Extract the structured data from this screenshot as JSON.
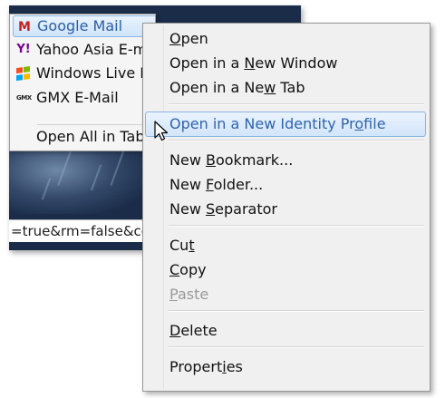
{
  "bookmarks_menu": {
    "items": [
      {
        "label": "Google Mail",
        "icon": "gmail-icon",
        "selected": true
      },
      {
        "label": "Yahoo Asia E-mail",
        "icon": "yahoo-icon"
      },
      {
        "label": "Windows Live E",
        "icon": "windows-icon"
      },
      {
        "label": "GMX E-Mail",
        "icon": "gmx-icon"
      }
    ],
    "open_all": "Open All in Tabs",
    "icons": {
      "gmail": "M",
      "yahoo": "Y!",
      "gmx": "GMX"
    }
  },
  "url_fragment": "=true&rm=false&co",
  "context_menu": {
    "items": [
      {
        "label": "Open",
        "accel": "O"
      },
      {
        "label": "Open in a New Window",
        "accel": "N"
      },
      {
        "label": "Open in a New Tab",
        "accel": "w"
      },
      {
        "label": "Open in a New Identity Profile",
        "accel": "o",
        "highlighted": true
      },
      {
        "label": "New Bookmark...",
        "accel": "B"
      },
      {
        "label": "New Folder...",
        "accel": "F"
      },
      {
        "label": "New Separator",
        "accel": "S"
      },
      {
        "label": "Cut",
        "accel": "t"
      },
      {
        "label": "Copy",
        "accel": "C"
      },
      {
        "label": "Paste",
        "accel": "P",
        "disabled": true
      },
      {
        "label": "Delete",
        "accel": "D"
      },
      {
        "label": "Properties",
        "accel": "i"
      }
    ]
  },
  "colors": {
    "highlight_text": "#2f64ad",
    "menu_bg": "#f0f0f0",
    "disabled_text": "#9a9a9a",
    "background_image": "#1a2c48"
  }
}
